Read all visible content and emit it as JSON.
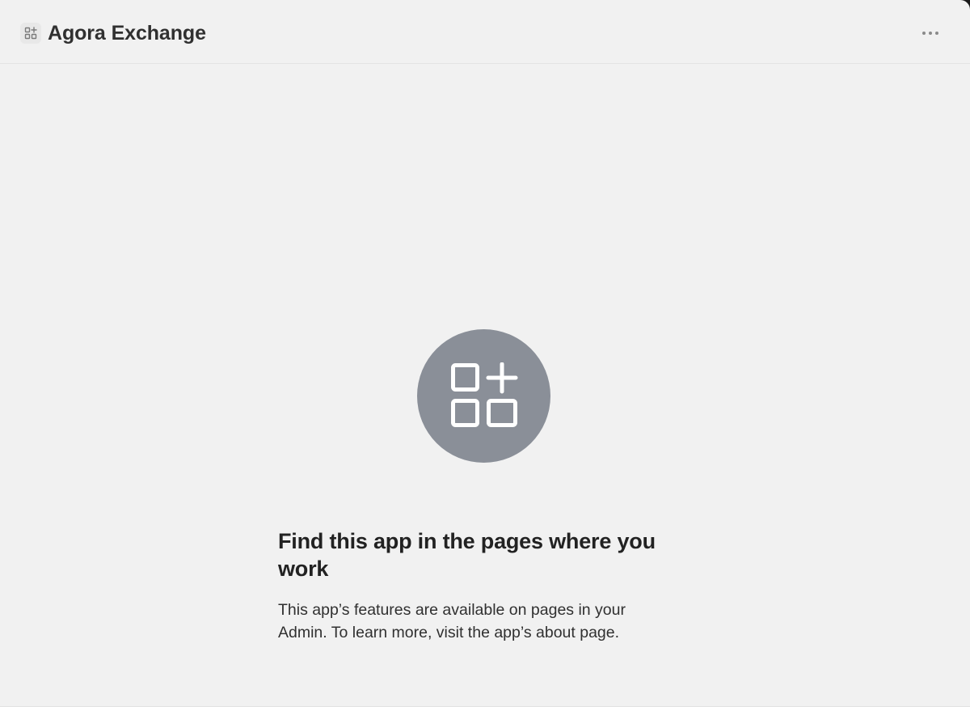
{
  "header": {
    "app_title": "Agora Exchange",
    "app_icon": "apps-plus-icon",
    "more_icon": "more-horizontal-icon"
  },
  "empty_state": {
    "illustration_icon": "apps-plus-icon",
    "heading": "Find this app in the pages where you work",
    "body": "This app’s features are available on pages in your Admin. To learn more, visit the app’s about page."
  },
  "colors": {
    "background": "#f1f1f1",
    "illustration_circle": "#8a8f98",
    "title_text": "#303030"
  }
}
